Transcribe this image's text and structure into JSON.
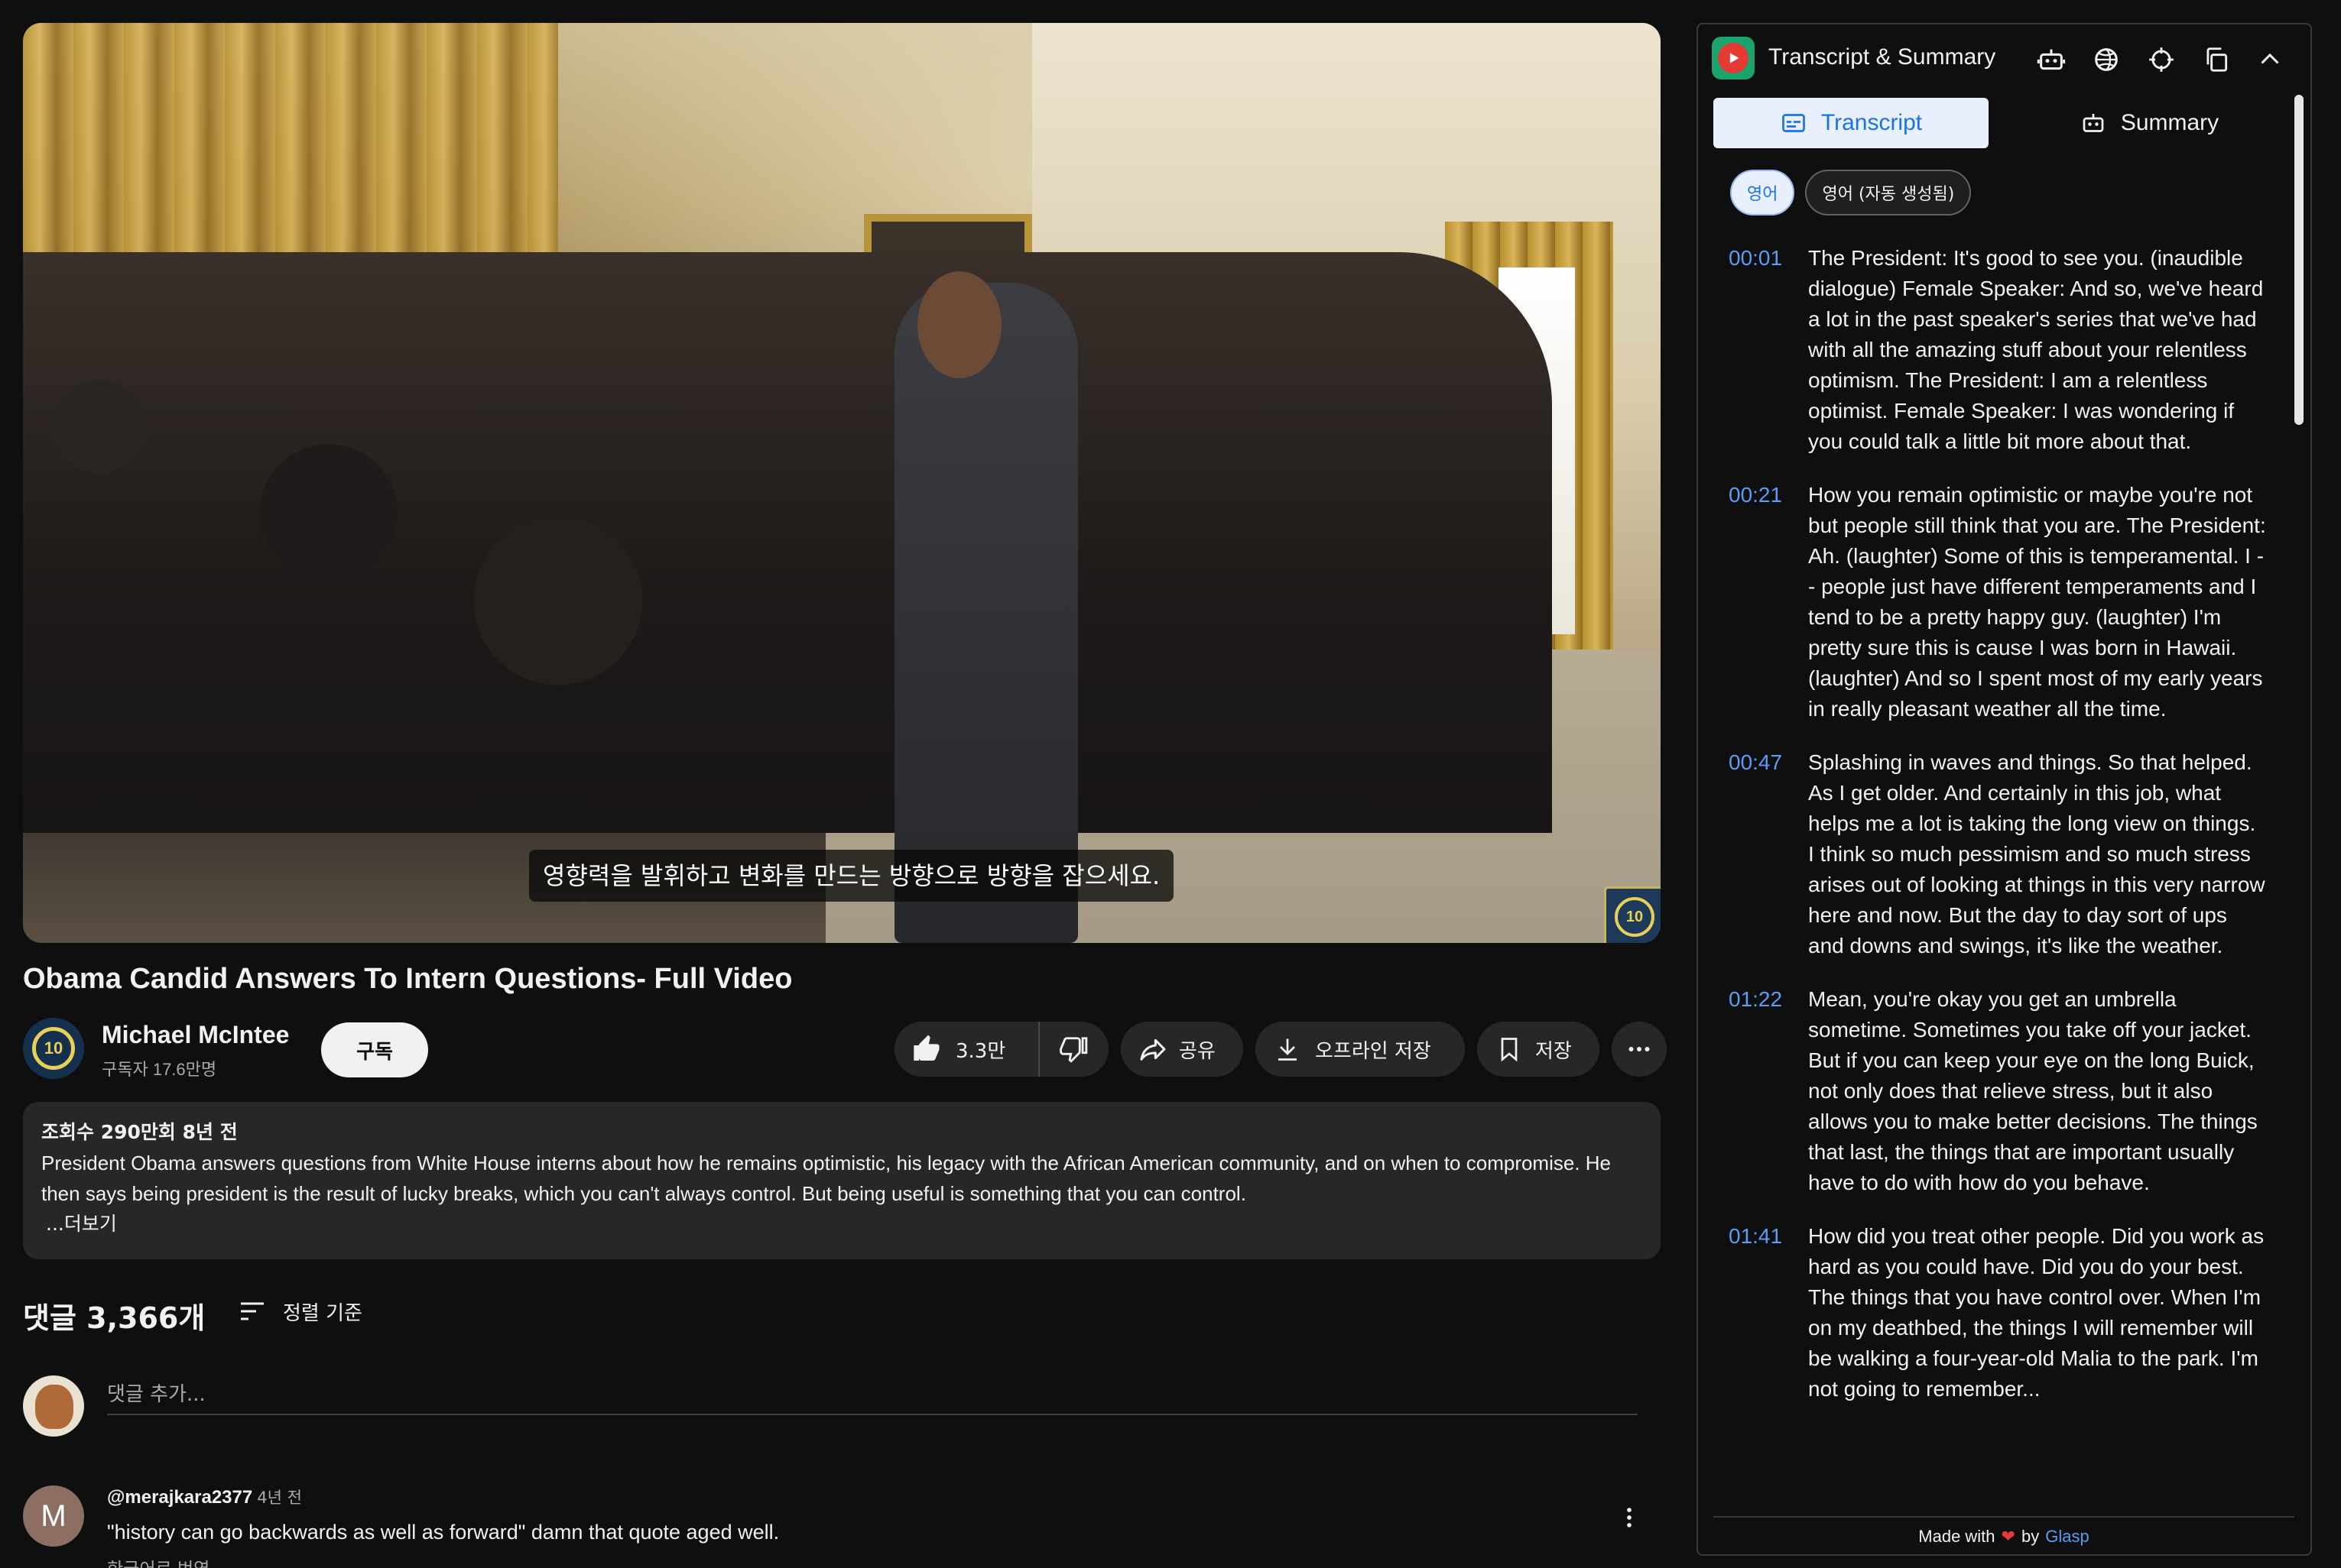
{
  "video": {
    "caption": "영향력을 발휘하고 변화를 만드는 방향으로 방향을 잡으세요.",
    "watermark_text": "10"
  },
  "title": "Obama Candid Answers To Intern Questions- Full Video",
  "channel": {
    "name": "Michael McIntee",
    "subscribers": "구독자 17.6만명",
    "subscribe_label": "구독",
    "avatar_text": "10"
  },
  "actions": {
    "like_count": "3.3만",
    "share_label": "공유",
    "download_label": "오프라인 저장",
    "save_label": "저장"
  },
  "description": {
    "meta": "조회수 290만회  8년 전",
    "text": "President Obama answers questions from White House interns about how he remains optimistic, his legacy with the African American community, and on when to compromise. He then says being president is the result of lucky breaks, which you can't always control. But being useful is something that you can control.",
    "more_label": "...더보기"
  },
  "comments": {
    "count_label": "댓글 3,366개",
    "sort_label": "정렬 기준",
    "add_placeholder": "댓글 추가...",
    "items": [
      {
        "avatar_letter": "M",
        "author": "@merajkara2377",
        "time": "4년 전",
        "text": "\"history can go backwards as well as forward\" damn that quote aged well.",
        "translate_label": "한국어로 번역"
      }
    ]
  },
  "panel": {
    "title": "Transcript & Summary",
    "tab_transcript": "Transcript",
    "tab_summary": "Summary",
    "lang_chips": [
      "영어",
      "영어 (자동 생성됨)"
    ],
    "transcript": [
      {
        "time": "00:01",
        "text": "The President: It's good to see you. (inaudible dialogue) Female Speaker: And so, we've heard a lot in the past speaker's series that we've had with all the amazing stuff about your relentless optimism. The President: I am a relentless optimist. Female Speaker: I was wondering if you could talk a little bit more about that."
      },
      {
        "time": "00:21",
        "text": "How you remain optimistic or maybe you're not but people still think that you are. The President: Ah. (laughter) Some of this is temperamental. I -- people just have different temperaments and I tend to be a pretty happy guy. (laughter) I'm pretty sure this is cause I was born in Hawaii. (laughter) And so I spent most of my early years in really pleasant weather all the time."
      },
      {
        "time": "00:47",
        "text": "Splashing in waves and things. So that helped. As I get older. And certainly in this job, what helps me a lot is taking the long view on things. I think so much pessimism and so much stress arises out of looking at things in this very narrow here and now. But the day to day sort of ups and downs and swings, it's like the weather."
      },
      {
        "time": "01:22",
        "text": "Mean, you're okay you get an umbrella sometime. Sometimes you take off your jacket. But if you can keep your eye on the long Buick, not only does that relieve stress, but it also allows you to make better decisions. The things that last, the things that are important usually have to do with how do you behave."
      },
      {
        "time": "01:41",
        "text": "How did you treat other people. Did you work as hard as you could have. Did you do your best. The things that you have control over. When I'm on my deathbed, the things I will remember will be walking a four-year-old Malia to the park. I'm not going to remember..."
      }
    ],
    "footer_made": "Made with",
    "footer_by": "by",
    "footer_brand": "Glasp"
  }
}
